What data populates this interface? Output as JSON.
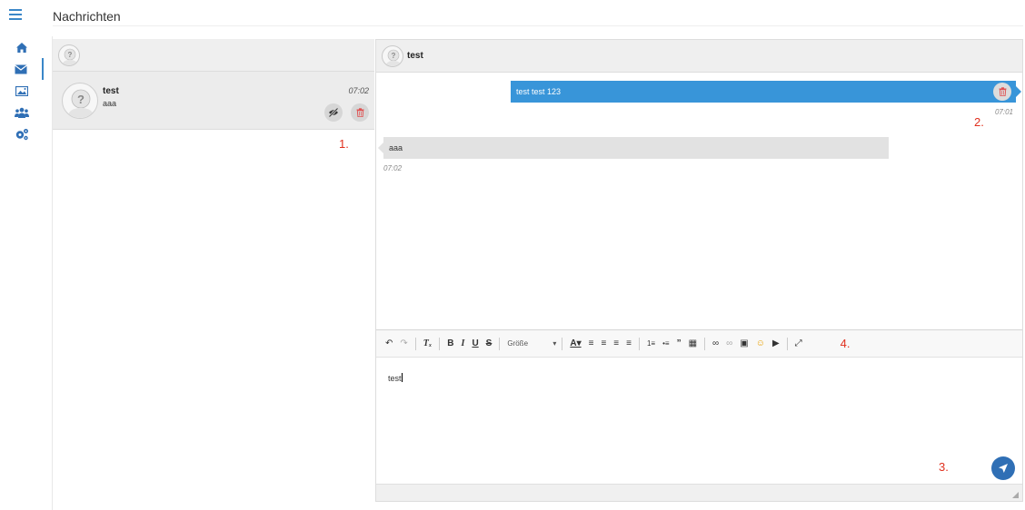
{
  "header": {
    "title": "Nachrichten"
  },
  "sidebar": {
    "items": [
      {
        "icon": "home-icon"
      },
      {
        "icon": "envelope-icon",
        "active": true
      },
      {
        "icon": "image-icon"
      },
      {
        "icon": "users-icon"
      },
      {
        "icon": "gears-icon"
      }
    ]
  },
  "conversations": [
    {
      "name": "test",
      "preview": "aaa",
      "time": "07:02"
    }
  ],
  "chat": {
    "title": "test",
    "messages": [
      {
        "direction": "out",
        "text": "test test 123",
        "time": "07:01"
      },
      {
        "direction": "in",
        "text": "aaa",
        "time": "07:02"
      }
    ]
  },
  "editor": {
    "size_label": "Größe",
    "content": "test"
  },
  "annotations": {
    "a1": "1.",
    "a2": "2.",
    "a3": "3.",
    "a4": "4."
  },
  "colors": {
    "accent": "#3895d9",
    "send": "#2f6fb5",
    "annotation": "#e0301e",
    "delete": "#e05050"
  }
}
